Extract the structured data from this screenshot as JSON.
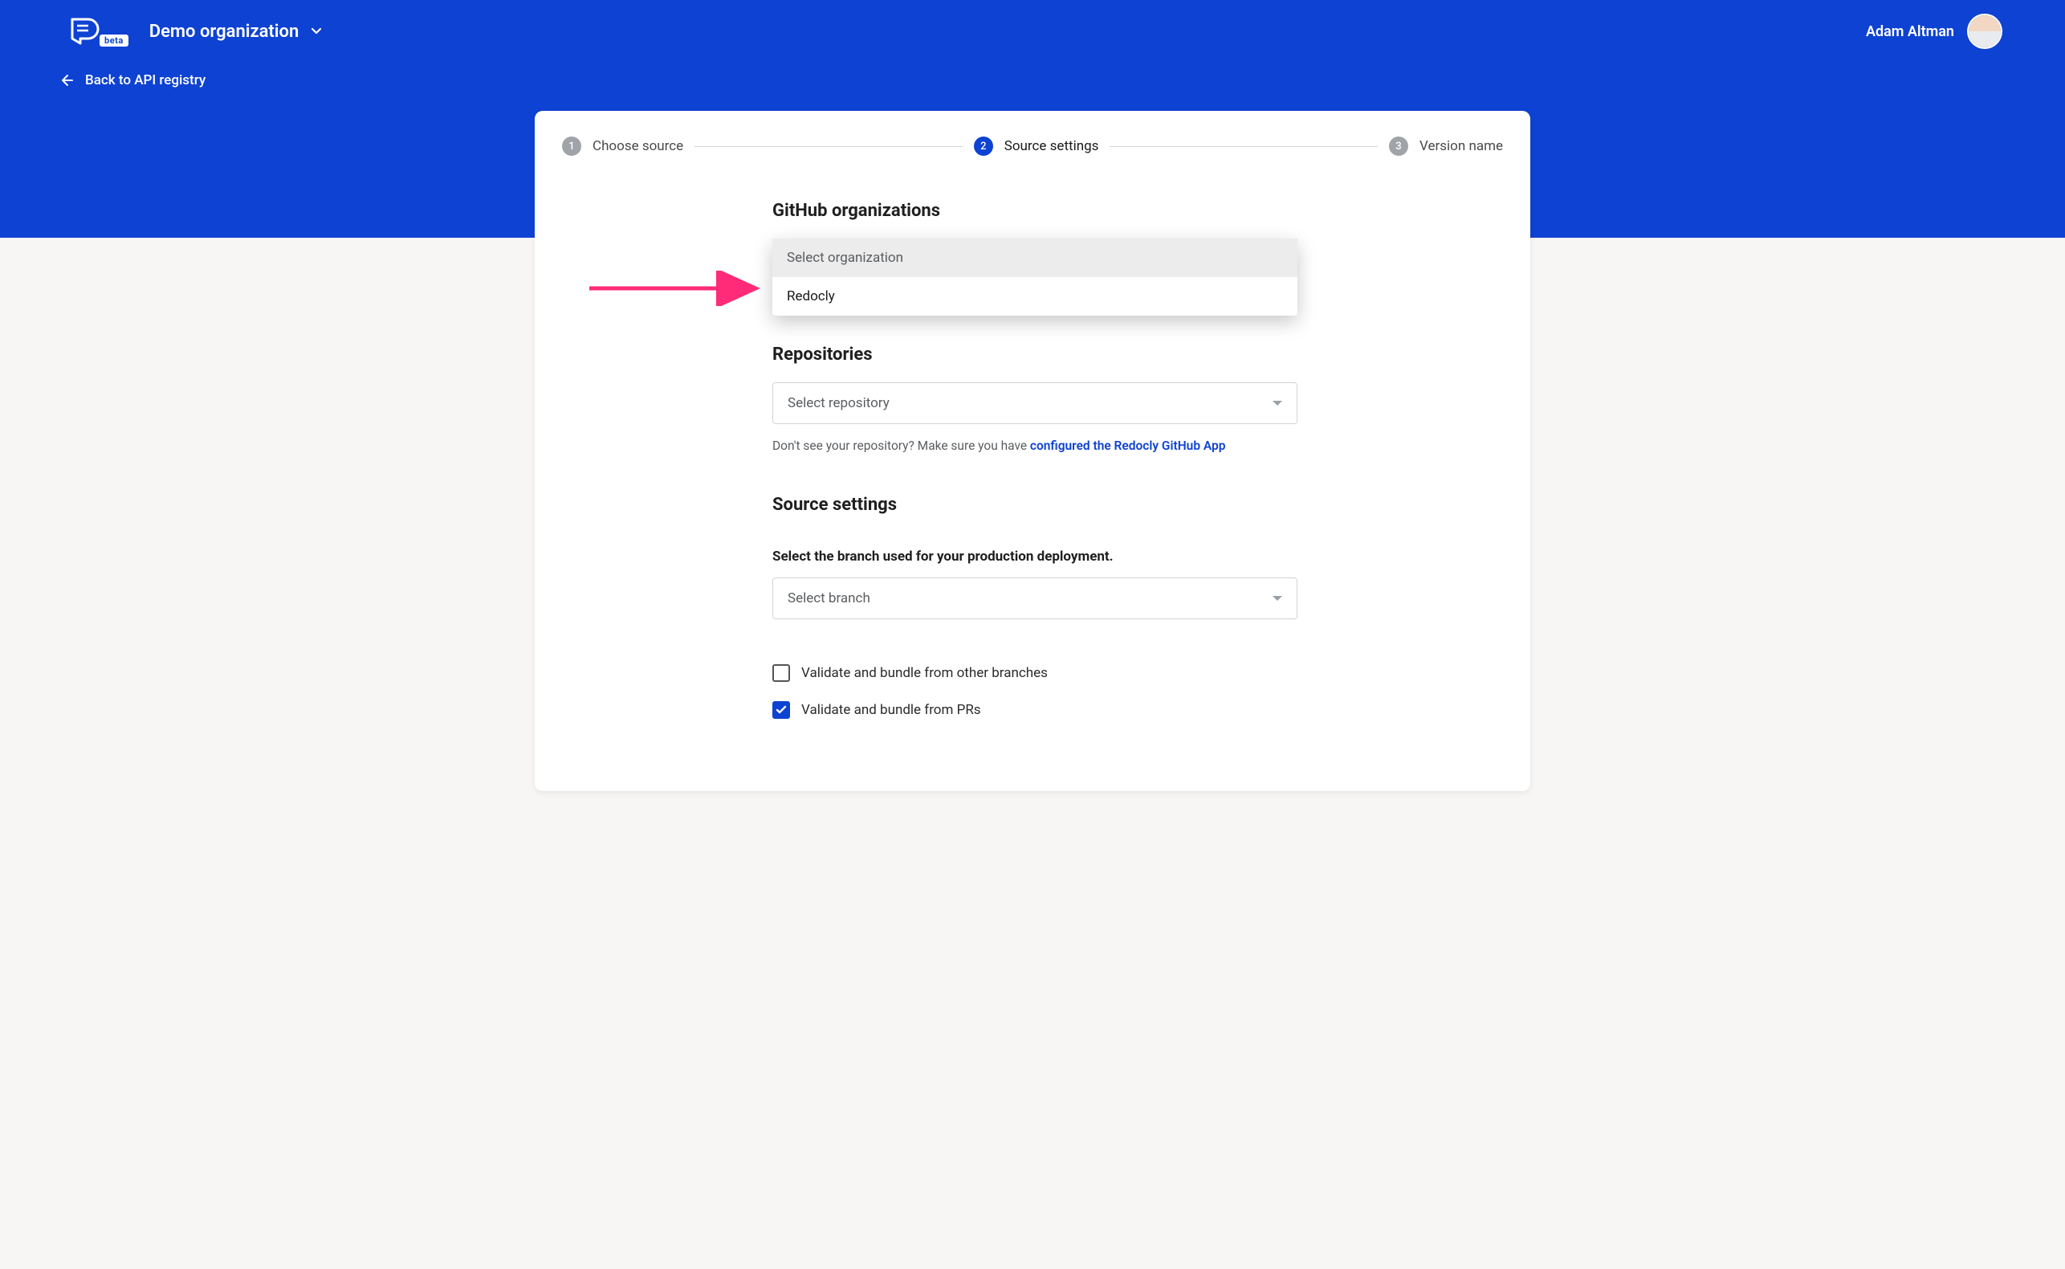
{
  "brand": {
    "beta_label": "beta"
  },
  "header": {
    "org_name": "Demo organization",
    "user_name": "Adam Altman"
  },
  "nav": {
    "back_label": "Back to API registry"
  },
  "stepper": {
    "steps": [
      {
        "num": "1",
        "label": "Choose source",
        "active": false
      },
      {
        "num": "2",
        "label": "Source settings",
        "active": true
      },
      {
        "num": "3",
        "label": "Version name",
        "active": false
      }
    ]
  },
  "form": {
    "orgs_heading": "GitHub organizations",
    "org_select_placeholder": "Select organization",
    "org_options": [
      "Redocly"
    ],
    "repos_heading": "Repositories",
    "repo_select_placeholder": "Select repository",
    "repo_help_prefix": "Don't see your repository? Make sure you have ",
    "repo_help_link": "configured the Redocly GitHub App",
    "settings_heading": "Source settings",
    "branch_instruction": "Select the branch used for your production deployment.",
    "branch_select_placeholder": "Select branch",
    "checkboxes": [
      {
        "label": "Validate and bundle from other branches",
        "checked": false
      },
      {
        "label": "Validate and bundle from PRs",
        "checked": true
      }
    ]
  },
  "colors": {
    "brand": "#0e42d2",
    "accent_arrow": "#ff2b78"
  }
}
